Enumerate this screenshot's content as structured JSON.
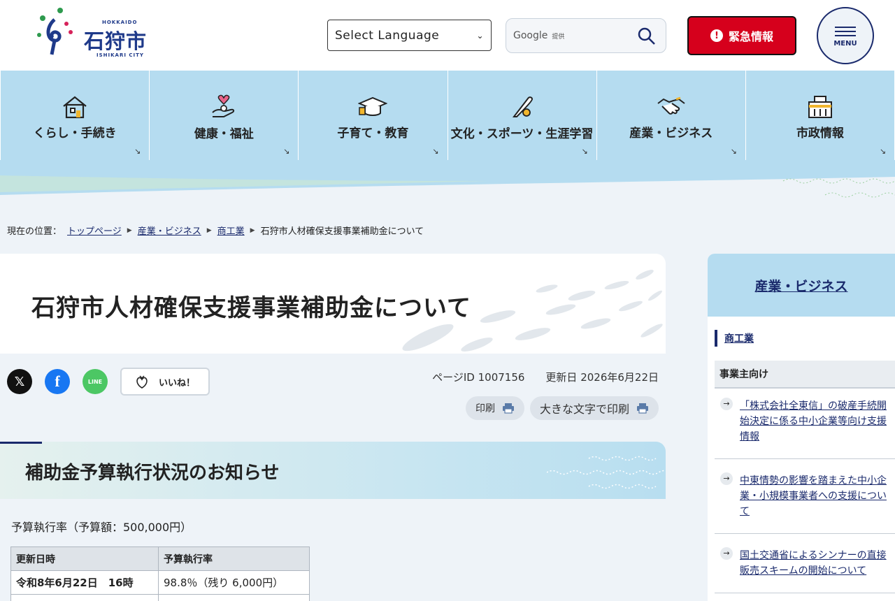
{
  "site": {
    "logo_prefecture": "HOKKAIDO",
    "logo_name": "石狩市",
    "logo_name_en": "ISHIKARI CITY"
  },
  "header": {
    "language_select": "Select Language",
    "search_brand": "Google",
    "search_provided": "提供",
    "emergency_label": "緊急情報",
    "menu_label": "MENU"
  },
  "nav": {
    "items": [
      {
        "label": "くらし・手続き",
        "icon": "house-icon"
      },
      {
        "label": "健康・福祉",
        "icon": "heart-hand-icon"
      },
      {
        "label": "子育て・教育",
        "icon": "graduation-cap-icon"
      },
      {
        "label": "文化・スポーツ・生涯学習",
        "icon": "sports-bat-icon"
      },
      {
        "label": "産業・ビジネス",
        "icon": "handshake-icon"
      },
      {
        "label": "市政情報",
        "icon": "city-hall-icon"
      }
    ],
    "corner_mark": "↘"
  },
  "breadcrumb": {
    "prefix": "現在の位置：",
    "items": [
      "トップページ",
      "産業・ビジネス",
      "商工業"
    ],
    "current": "石狩市人材確保支援事業補助金について"
  },
  "page": {
    "title": "石狩市人材確保支援事業補助金について",
    "like_label": "いいね！",
    "page_id": "ページID 1007156",
    "updated": "更新日 2026年6月22日",
    "print_label": "印刷",
    "print_large_label": "大きな文字で印刷"
  },
  "section": {
    "heading": "補助金予算執行状況のお知らせ",
    "budget_text": "予算執行率（予算額：500,000円）",
    "table": {
      "headers": [
        "更新日時",
        "予算執行率"
      ],
      "rows": [
        [
          "令和8年6月22日　16時",
          "98.8％（残り 6,000円）"
        ]
      ]
    }
  },
  "sidebar": {
    "heading": "産業・ビジネス",
    "sub_link": "商工業",
    "category": "事業主向け",
    "links": [
      "「株式会社全東信」の破産手続開始決定に係る中小企業等向け支援情報",
      "中東情勢の影響を踏まえた中小企業・小規模事業者への支援について",
      "国土交通省によるシンナーの直接販売スキームの開始について"
    ]
  },
  "colors": {
    "nav_bg": "#b5dcf0",
    "emergency": "#d6001c",
    "link": "#1a2a6c",
    "page_bg": "#eef3f8"
  }
}
